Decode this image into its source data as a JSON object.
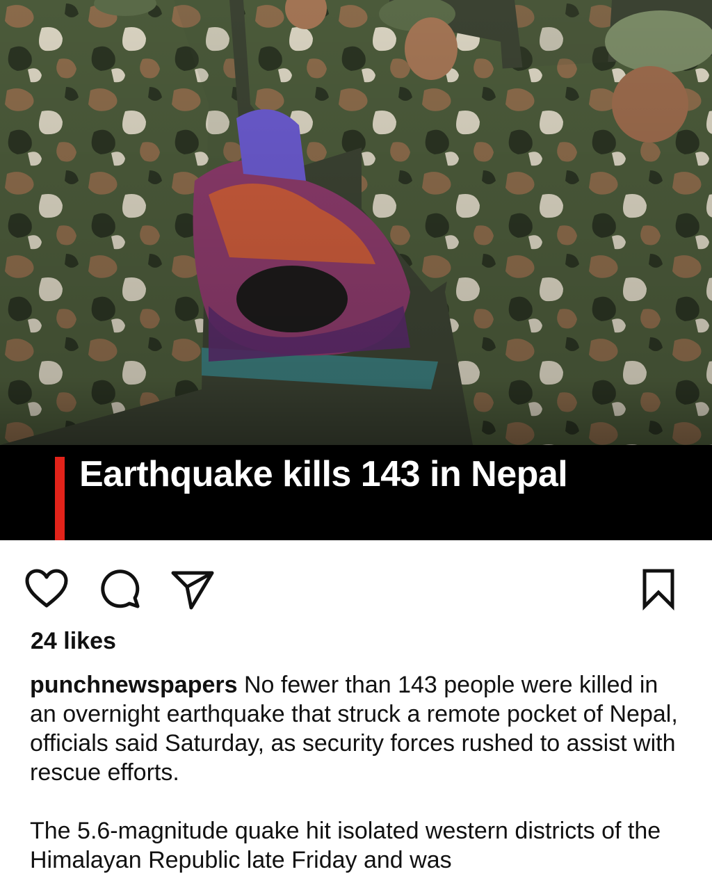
{
  "post": {
    "image": {
      "description_icon": "photo-image",
      "headline": "Earthquake kills 143 in Nepal",
      "accent_color": "#e2231a"
    },
    "actions": {
      "like_icon": "heart-icon",
      "comment_icon": "comment-icon",
      "share_icon": "paper-plane-icon",
      "save_icon": "bookmark-icon"
    },
    "likes_text": "24 likes",
    "caption": {
      "username": "punchnewspapers",
      "paragraph1": " No fewer than 143 people were killed in an overnight earthquake that struck a remote pocket of Nepal, officials said Saturday, as security forces rushed to assist with rescue efforts.",
      "paragraph2": "The 5.6-magnitude quake hit isolated western districts of the Himalayan Republic late Friday and was"
    }
  }
}
